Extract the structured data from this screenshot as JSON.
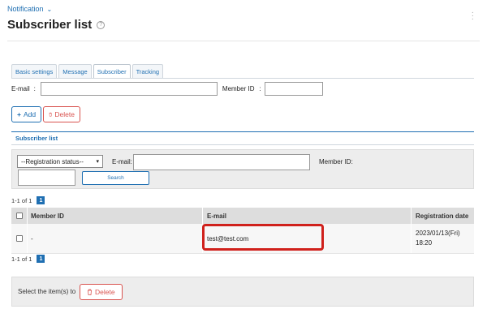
{
  "header": {
    "menu_label": "Notification",
    "title": "Subscriber list"
  },
  "tabs": [
    {
      "label": "Basic settings",
      "active": false
    },
    {
      "label": "Message",
      "active": false
    },
    {
      "label": "Subscriber",
      "active": true
    },
    {
      "label": "Tracking",
      "active": false
    }
  ],
  "filter": {
    "email_label": "E-mail",
    "email_value": "",
    "member_label": "Member ID",
    "member_value": "",
    "sep": ":"
  },
  "actions": {
    "add_label": "Add",
    "delete_label": "Delete"
  },
  "section": {
    "title": "Subscriber list"
  },
  "search": {
    "status_selected": "--Registration status--",
    "email_label": "E-mail:",
    "email_value": "",
    "member_label": "Member ID:",
    "member_value": "",
    "search_button": "Search"
  },
  "pagination": {
    "range_text": "1-1 of 1",
    "current_page": "1"
  },
  "table": {
    "columns": [
      "Member ID",
      "E-mail",
      "Registration date"
    ],
    "rows": [
      {
        "member_id": "-",
        "email": "test@test.com",
        "date_line1": "2023/01/13(Fri)",
        "date_line2": "18:20"
      }
    ]
  },
  "bulk": {
    "label": "Select the item(s) to",
    "delete_label": "Delete"
  },
  "colors": {
    "accent": "#1f6fb2",
    "danger": "#d9534f",
    "highlight": "#d0211c"
  }
}
